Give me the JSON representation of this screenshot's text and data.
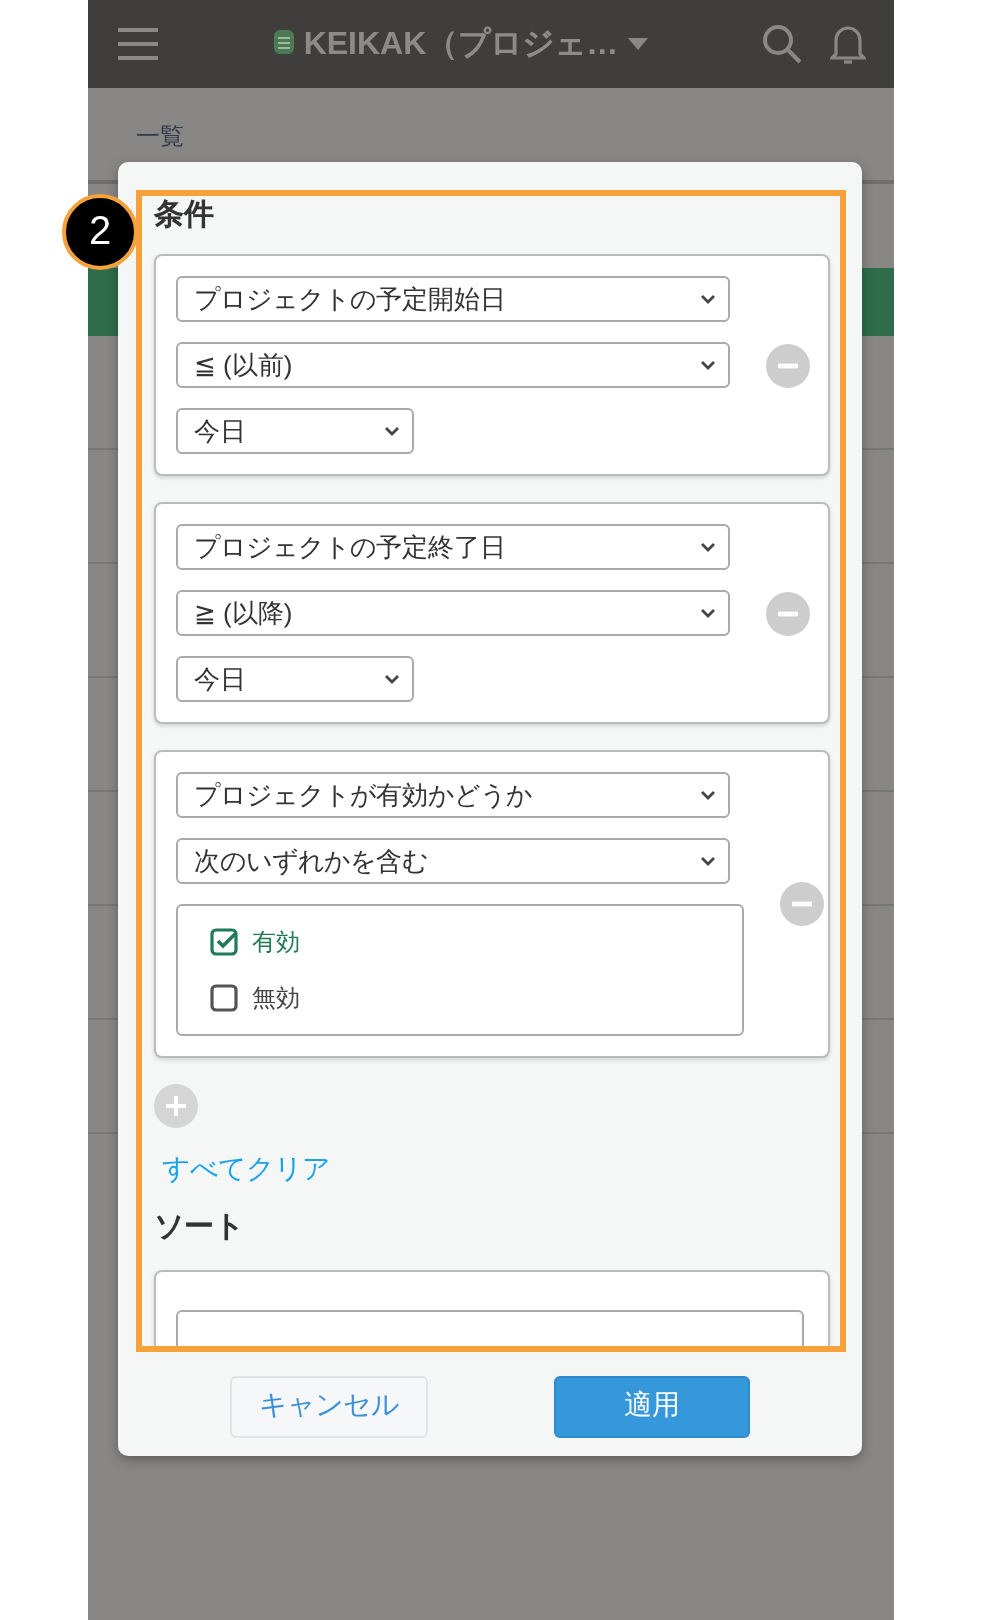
{
  "header": {
    "title": "KEIKAK（プロジェ…"
  },
  "tab": {
    "label": "一覧"
  },
  "badge": "2",
  "filter": {
    "heading": "条件",
    "conditions": [
      {
        "kind": "date",
        "field": "プロジェクトの予定開始日",
        "operator": "≦ (以前)",
        "value": "今日"
      },
      {
        "kind": "date",
        "field": "プロジェクトの予定終了日",
        "operator": "≧ (以降)",
        "value": "今日"
      },
      {
        "kind": "options",
        "field": "プロジェクトが有効かどうか",
        "operator": "次のいずれかを含む",
        "options": [
          {
            "label": "有効",
            "checked": true
          },
          {
            "label": "無効",
            "checked": false
          }
        ]
      }
    ],
    "clear": "すべてクリア"
  },
  "sort": {
    "heading": "ソート"
  },
  "buttons": {
    "cancel": "キャンセル",
    "apply": "適用"
  }
}
